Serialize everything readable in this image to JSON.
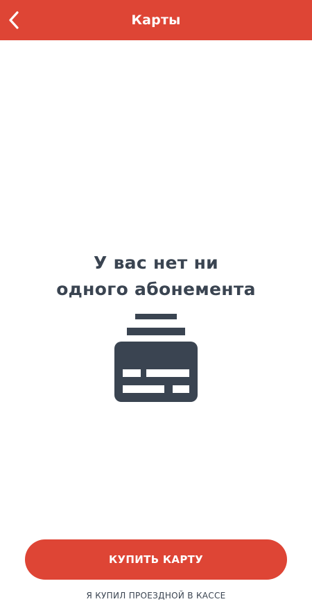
{
  "header": {
    "title": "Карты",
    "back_icon": "chevron-left-icon"
  },
  "empty_state": {
    "line1": "У вас нет ни",
    "line2": "одного абонемента",
    "icon": "card-stack-icon"
  },
  "actions": {
    "buy_label": "КУПИТЬ КАРТУ",
    "bought_at_counter_label": "Я КУПИЛ ПРОЕЗДНОЙ В КАССЕ"
  },
  "colors": {
    "accent": "#de4535",
    "text_dark": "#3a4451"
  }
}
